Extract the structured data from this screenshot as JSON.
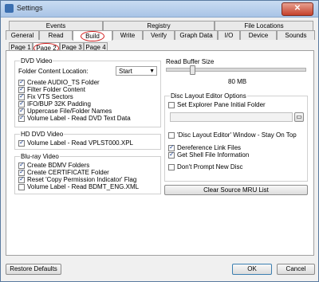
{
  "window": {
    "title": "Settings",
    "close_symbol": "✕"
  },
  "tabs_top": [
    "Events",
    "Registry",
    "File Locations"
  ],
  "tabs_main": [
    "General",
    "Read",
    "Build",
    "Write",
    "Verify",
    "Graph Data",
    "I/O",
    "Device",
    "Sounds"
  ],
  "tabs_sub": [
    "Page 1",
    "Page 2",
    "Page 3",
    "Page 4"
  ],
  "dvd_video": {
    "title": "DVD Video",
    "folder_location_label": "Folder Content Location:",
    "folder_location_value": "Start",
    "options": [
      {
        "label": "Create AUDIO_TS Folder",
        "checked": true
      },
      {
        "label": "Filter Folder Content",
        "checked": true
      },
      {
        "label": "Fix VTS Sectors",
        "checked": true
      },
      {
        "label": "IFO/BUP 32K Padding",
        "checked": true
      },
      {
        "label": "Uppercase File/Folder Names",
        "checked": true
      },
      {
        "label": "Volume Label - Read DVD Text Data",
        "checked": true
      }
    ]
  },
  "hd_dvd_video": {
    "title": "HD DVD Video",
    "options": [
      {
        "label": "Volume Label - Read VPLST000.XPL",
        "checked": true
      }
    ]
  },
  "bluray_video": {
    "title": "Blu-ray Video",
    "options": [
      {
        "label": "Create BDMV Folders",
        "checked": true
      },
      {
        "label": "Create CERTIFICATE Folder",
        "checked": true
      },
      {
        "label": "Reset 'Copy Permission Indicator' Flag",
        "checked": true
      },
      {
        "label": "Volume Label - Read BDMT_ENG.XML",
        "checked": false
      }
    ]
  },
  "read_buffer": {
    "title": "Read Buffer Size",
    "value_text": "80 MB",
    "level": 0.18
  },
  "disc_layout": {
    "title": "Disc Layout Editor Options",
    "set_explorer_label": "Set Explorer Pane Initial Folder",
    "set_explorer_checked": false,
    "stay_on_top_label": "'Disc Layout Editor' Window - Stay On Top",
    "stay_on_top_checked": false,
    "deref_label": "Dereference Link Files",
    "deref_checked": true,
    "shell_info_label": "Get Shell File Information",
    "shell_info_checked": true,
    "dont_prompt_label": "Don't Prompt New Disc",
    "dont_prompt_checked": false
  },
  "buttons": {
    "clear_mru": "Clear Source MRU List",
    "restore_defaults": "Restore Defaults",
    "ok": "OK",
    "cancel": "Cancel"
  },
  "icons": {
    "browse": "folder-icon",
    "dropdown": "chevron-down-icon"
  }
}
